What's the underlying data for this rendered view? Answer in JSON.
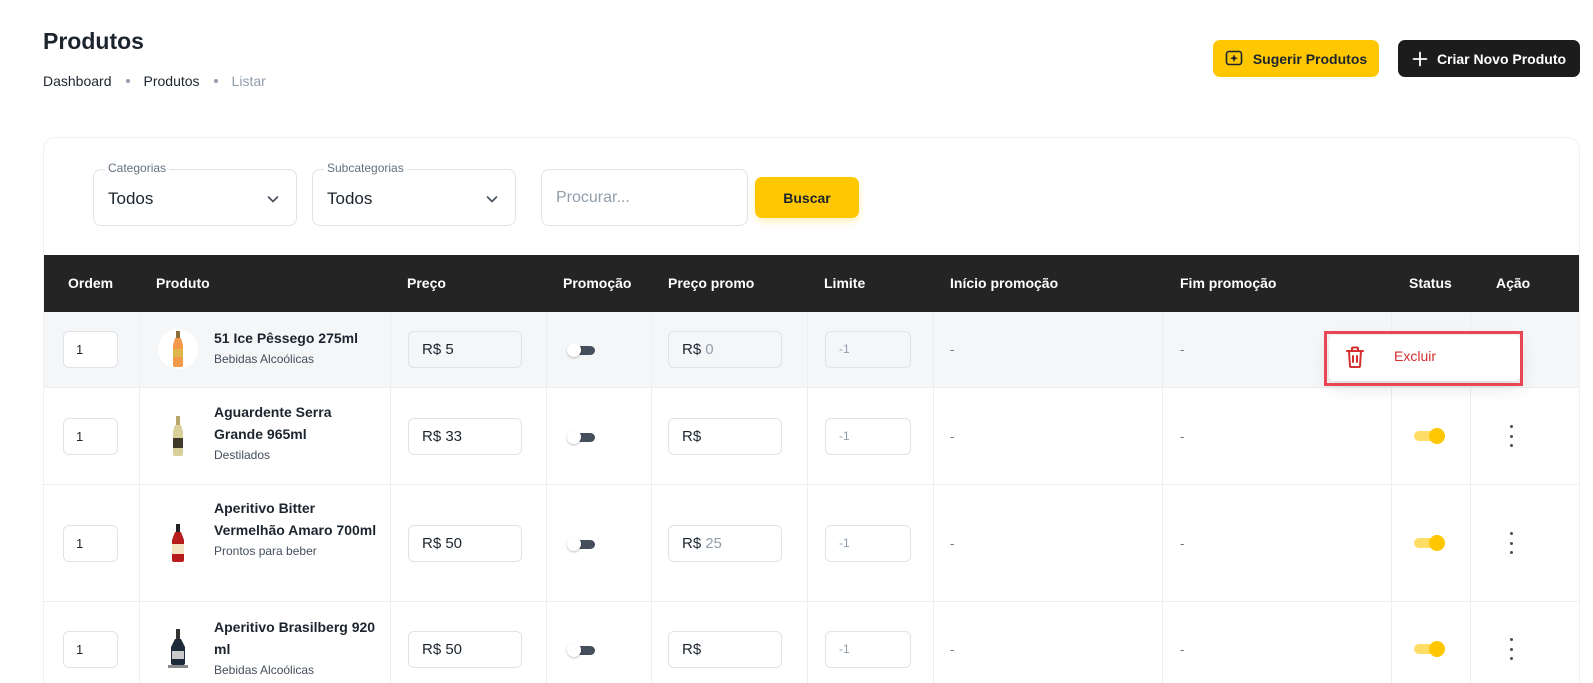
{
  "header": {
    "title": "Produtos",
    "breadcrumb": [
      "Dashboard",
      "Produtos",
      "Listar"
    ],
    "suggest_button": "Sugerir Produtos",
    "new_button": "Criar Novo Produto",
    "suggest_icon": "suggest-sparkle-icon",
    "new_icon": "plus-icon",
    "accent_color": "#ffc700",
    "dark_color": "#1c1c1c"
  },
  "filters": {
    "category": {
      "label": "Categorias",
      "value": "Todos"
    },
    "subcategory": {
      "label": "Subcategorias",
      "value": "Todos"
    },
    "search_placeholder": "Procurar...",
    "search_button": "Buscar"
  },
  "table": {
    "columns": [
      "Ordem",
      "Produto",
      "Preço",
      "Promoção",
      "Preço promo",
      "Limite",
      "Início promoção",
      "Fim promoção",
      "Status",
      "Ação"
    ],
    "rows": [
      {
        "order": "1",
        "name": "51 Ice Pêssego 275ml",
        "category": "Bebidas Alcoólicas",
        "price": "R$  5",
        "promotion": false,
        "promo_price": "R$",
        "promo_value": "0",
        "limit": "-1",
        "promo_start": "-",
        "promo_end": "-",
        "status": false,
        "highlighted": true
      },
      {
        "order": "1",
        "name": "Aguardente Serra Grande 965ml",
        "category": "Destilados",
        "price": "R$  33",
        "promotion": false,
        "promo_price": "R$",
        "promo_value": "",
        "limit": "-1",
        "promo_start": "-",
        "promo_end": "-",
        "status": true,
        "highlighted": false
      },
      {
        "order": "1",
        "name": "Aperitivo Bitter Vermelhão Amaro 700ml",
        "category": "Prontos para beber",
        "price": "R$  50",
        "promotion": false,
        "promo_price": "R$",
        "promo_value": "25",
        "limit": "-1",
        "promo_start": "-",
        "promo_end": "-",
        "status": true,
        "highlighted": false
      },
      {
        "order": "1",
        "name": "Aperitivo Brasilberg 920 ml",
        "category": "Bebidas Alcoólicas",
        "price": "R$  50",
        "promotion": false,
        "promo_price": "R$",
        "promo_value": "",
        "limit": "-1",
        "promo_start": "-",
        "promo_end": "-",
        "status": true,
        "highlighted": false
      }
    ]
  },
  "row_menu": {
    "delete_label": "Excluir",
    "delete_icon": "trash-icon",
    "danger_color": "#d32f2f"
  }
}
